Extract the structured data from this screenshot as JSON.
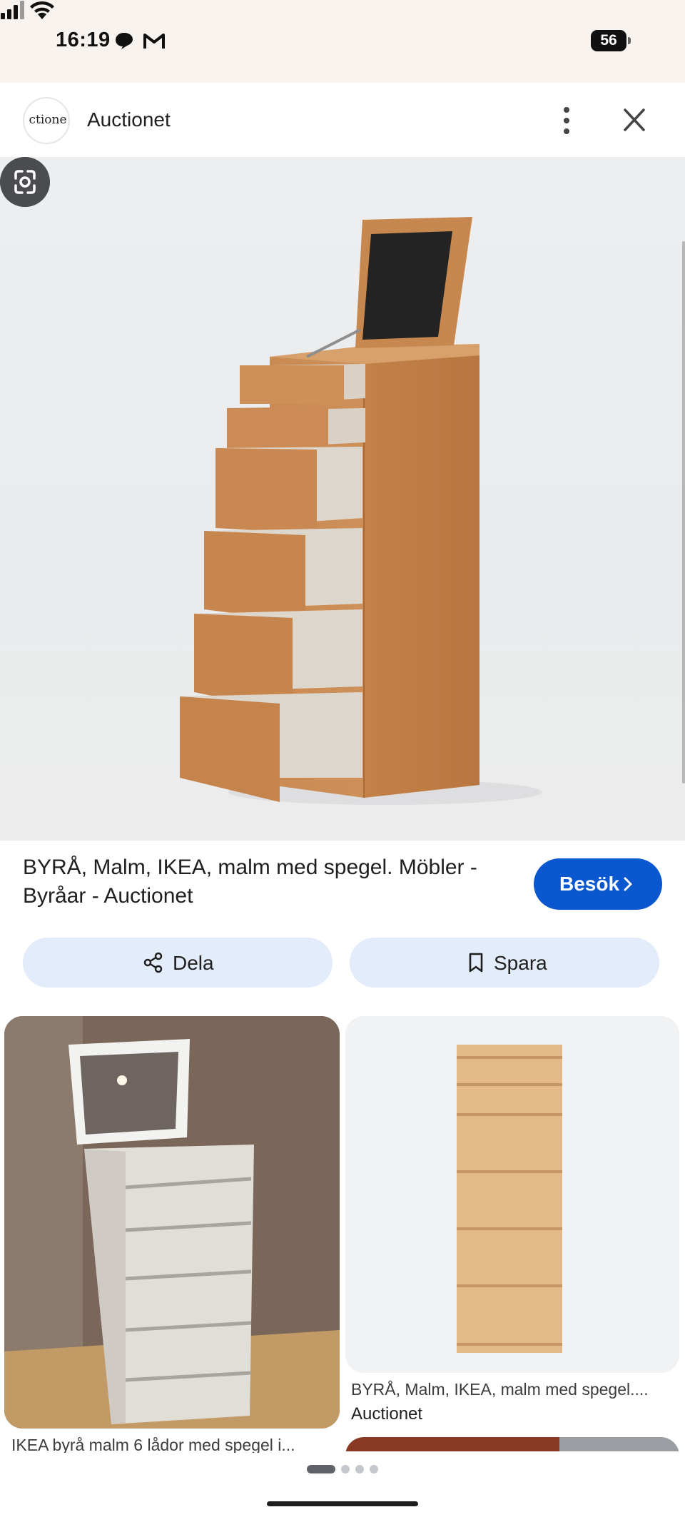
{
  "status_bar": {
    "time": "16:19",
    "battery": "56",
    "notification_icons": [
      "chat-bubble-icon",
      "gmail-icon"
    ],
    "system_icons": [
      "signal-icon",
      "wifi-icon",
      "battery-icon"
    ]
  },
  "header": {
    "site_name": "Auctionet",
    "logo_text": "ctione",
    "menu_icon": "more-vert-icon",
    "close_icon": "close-icon"
  },
  "image": {
    "lens_icon": "google-lens-icon"
  },
  "result": {
    "title": "BYRÅ, Malm, IKEA, malm med spegel. Möbler - Byråar - Auctionet",
    "visit_label": "Besök",
    "share_label": "Dela",
    "save_label": "Spara"
  },
  "related": [
    {
      "caption": "IKEA byrå malm 6 lådor med spegel i..."
    },
    {
      "caption": "BYRÅ, Malm, IKEA, malm med spegel....",
      "source": "Auctionet"
    }
  ],
  "pager": {
    "total": 4,
    "active": 1
  },
  "colors": {
    "accent": "#0b57d0",
    "chip_bg": "#e3ecfa",
    "status_bar_bg": "#f8f3ef"
  }
}
